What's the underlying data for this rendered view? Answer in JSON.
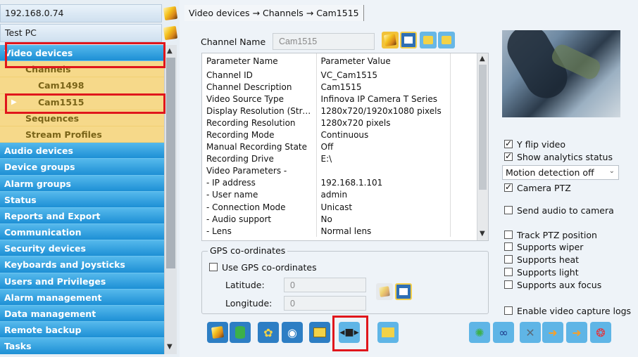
{
  "servers": [
    {
      "label": "192.168.0.74"
    },
    {
      "label": "Test PC"
    }
  ],
  "tree": [
    {
      "label": "Video devices",
      "kind": "cat"
    },
    {
      "label": "Channels",
      "kind": "sub",
      "indent": 1
    },
    {
      "label": "Cam1498",
      "kind": "sub",
      "indent": 2
    },
    {
      "label": "Cam1515",
      "kind": "sub",
      "indent": 2,
      "selected": true
    },
    {
      "label": "Sequences",
      "kind": "sub",
      "indent": 1
    },
    {
      "label": "Stream Profiles",
      "kind": "sub",
      "indent": 1
    },
    {
      "label": "Audio devices",
      "kind": "cat"
    },
    {
      "label": "Device groups",
      "kind": "cat"
    },
    {
      "label": "Alarm groups",
      "kind": "cat"
    },
    {
      "label": "Status",
      "kind": "cat"
    },
    {
      "label": "Reports and Export",
      "kind": "cat"
    },
    {
      "label": "Communication",
      "kind": "cat"
    },
    {
      "label": "Security devices",
      "kind": "cat"
    },
    {
      "label": "Keyboards and Joysticks",
      "kind": "cat"
    },
    {
      "label": "Users and Privileges",
      "kind": "cat"
    },
    {
      "label": "Alarm management",
      "kind": "cat"
    },
    {
      "label": "Data management",
      "kind": "cat"
    },
    {
      "label": "Remote backup",
      "kind": "cat"
    },
    {
      "label": "Tasks",
      "kind": "cat"
    }
  ],
  "breadcrumb": "Video devices → Channels → Cam1515",
  "channel": {
    "label": "Channel Name",
    "value": "Cam1515"
  },
  "params": {
    "headers": [
      "Parameter Name",
      "Parameter Value"
    ],
    "rows": [
      [
        "Channel ID",
        "VC_Cam1515"
      ],
      [
        "Channel Description",
        "Cam1515"
      ],
      [
        "Video Source Type",
        "Infinova IP Camera T Series"
      ],
      [
        "Display Resolution (Stre...",
        "1280x720/1920x1080 pixels"
      ],
      [
        "Recording Resolution",
        "1280x720 pixels"
      ],
      [
        "Recording Mode",
        "Continuous"
      ],
      [
        "Manual Recording State",
        "Off"
      ],
      [
        "Recording Drive",
        "E:\\"
      ],
      [
        "Video Parameters -",
        ""
      ],
      [
        "- IP address",
        "192.168.1.101"
      ],
      [
        "- User name",
        "admin"
      ],
      [
        "- Connection Mode",
        "Unicast"
      ],
      [
        "- Audio support",
        "No"
      ],
      [
        "- Lens",
        "Normal lens"
      ]
    ]
  },
  "gps": {
    "legend": "GPS co-ordinates",
    "use_label": "Use GPS co-ordinates",
    "latitude_label": "Latitude:",
    "latitude_value": "0",
    "longitude_label": "Longitude:",
    "longitude_value": "0"
  },
  "options": {
    "y_flip": "Y flip video",
    "show_analytics": "Show analytics status",
    "motion_detection": "Motion detection off",
    "camera_ptz": "Camera PTZ",
    "send_audio": "Send audio to camera",
    "track_ptz": "Track PTZ position",
    "wiper": "Supports wiper",
    "heat": "Supports heat",
    "light": "Supports light",
    "aux_focus": "Supports aux focus",
    "capture_logs": "Enable video capture logs"
  },
  "colors": {
    "accent_blue": "#1d8fd5",
    "highlight_red": "#e0161c",
    "sub_bg": "#f6d98a"
  },
  "icons": [
    "pencil-icon",
    "save-icon",
    "copy-icon",
    "database-icon",
    "settings-icon",
    "eye-icon",
    "book-icon",
    "camera-transfer-icon",
    "alarm-folder-icon",
    "network-icon",
    "glasses-icon",
    "tools-icon",
    "arrow-right-icon",
    "lifebuoy-icon"
  ]
}
